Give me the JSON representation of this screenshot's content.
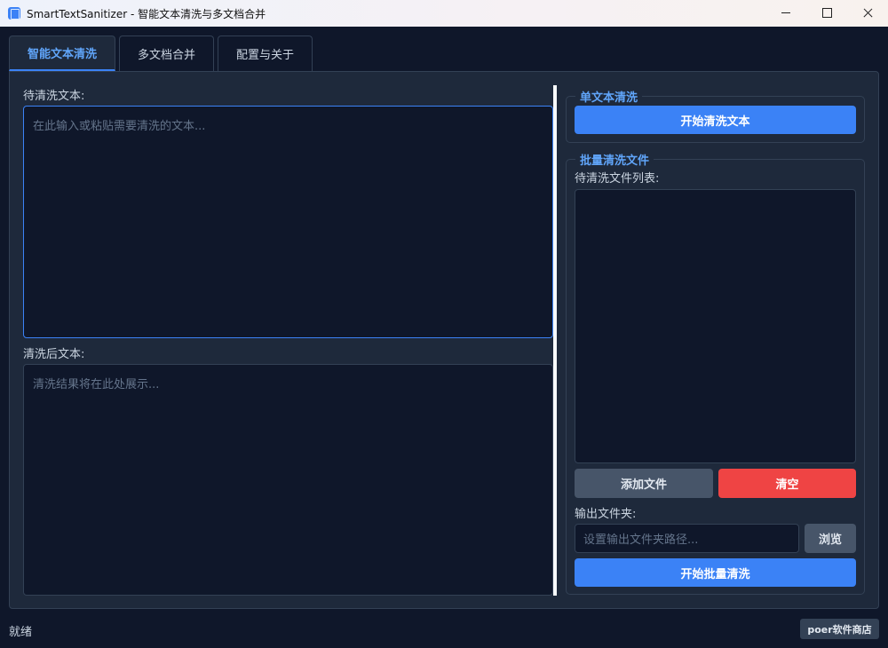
{
  "window": {
    "title": "SmartTextSanitizer - 智能文本清洗与多文档合并",
    "icon": "document-icon"
  },
  "tabs": [
    {
      "label": "智能文本清洗",
      "active": true
    },
    {
      "label": "多文档合并",
      "active": false
    },
    {
      "label": "配置与关于",
      "active": false
    }
  ],
  "left": {
    "input_label": "待清洗文本:",
    "input_placeholder": "在此输入或粘贴需要清洗的文本...",
    "output_label": "清洗后文本:",
    "output_placeholder": "清洗结果将在此处展示..."
  },
  "single": {
    "group_title": "单文本清洗",
    "start_button": "开始清洗文本"
  },
  "batch": {
    "group_title": "批量清洗文件",
    "list_label": "待清洗文件列表:",
    "add_button": "添加文件",
    "clear_button": "清空",
    "output_folder_label": "输出文件夹:",
    "output_folder_placeholder": "设置输出文件夹路径...",
    "browse_button": "浏览",
    "start_button": "开始批量清洗"
  },
  "status": {
    "text": "就绪",
    "store_badge": "poer软件商店"
  },
  "colors": {
    "accent": "#3b82f6",
    "danger": "#ef4444",
    "background": "#0f172a",
    "panel": "#1e293b"
  }
}
